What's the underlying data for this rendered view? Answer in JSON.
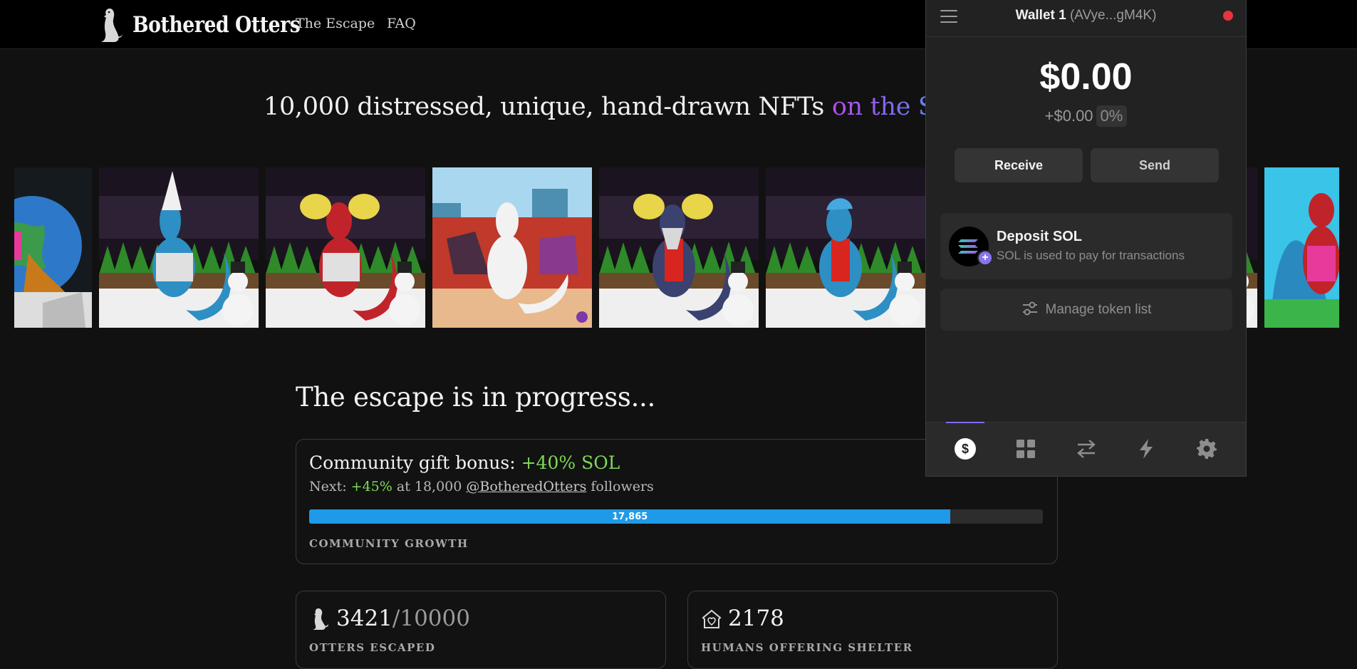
{
  "site": {
    "brand": "Bothered Otters",
    "nav": [
      {
        "label": "The Escape"
      },
      {
        "label": "FAQ"
      }
    ],
    "tagline_main": "10,000 distressed, unique, hand-drawn NFTs ",
    "tagline_highlight": "on the Solar"
  },
  "carousel": {
    "tiles": [
      {
        "subject": "otter-with-earth",
        "bg": "#1a1a1a"
      },
      {
        "subject": "blue-otter-dunce-cap",
        "otter_color": "#2d8fc4",
        "accessory": "#e8e8e8"
      },
      {
        "subject": "red-otter-pigtails",
        "otter_color": "#c0242a",
        "accessory": "#e8d54a"
      },
      {
        "subject": "white-otter-graffiti",
        "otter_color": "#f2f2f2",
        "accessory": "#7a3aa8"
      },
      {
        "subject": "navy-otter-pigtails-scarf",
        "otter_color": "#3b4270",
        "accessory": "#e8d54a"
      },
      {
        "subject": "blue-otter-cap-scarf",
        "otter_color": "#2d8fc4",
        "accessory": "#46a8e0"
      },
      {
        "subject": "partial-otter",
        "otter_color": "#2d8fc4"
      },
      {
        "subject": "red-otter-cyan-sky",
        "otter_color": "#c0242a"
      }
    ]
  },
  "progress": {
    "title": "The escape is in progress...",
    "gift_label": "Community gift bonus: ",
    "gift_value": "+40% SOL",
    "next_prefix": "Next: ",
    "next_value": "+45%",
    "next_middle": " at 18,000 ",
    "next_handle": "@BotheredOtters",
    "next_suffix": " followers",
    "bar_value": 17865,
    "bar_max": 20435,
    "bar_label": "17,865",
    "bar_caption": "COMMUNITY GROWTH",
    "bar_color": "#1f9ae8"
  },
  "stats": {
    "escaped_value": "3421",
    "escaped_total": "/10000",
    "escaped_caption": "OTTERS ESCAPED",
    "shelter_value": "2178",
    "shelter_caption": "HUMANS OFFERING SHELTER"
  },
  "wallet": {
    "name": "Wallet 1",
    "address": "(AVye...gM4K)",
    "balance": "$0.00",
    "change": "+$0.00",
    "change_pct": "0%",
    "receive_label": "Receive",
    "send_label": "Send",
    "deposit_title": "Deposit SOL",
    "deposit_subtitle": "SOL is used to pay for transactions",
    "manage_label": "Manage token list",
    "status_color": "#e8343f",
    "accent": "#7c6cf2",
    "tabs": [
      {
        "icon": "dollar-icon",
        "active": true
      },
      {
        "icon": "grid-icon",
        "active": false
      },
      {
        "icon": "swap-icon",
        "active": false
      },
      {
        "icon": "lightning-icon",
        "active": false
      },
      {
        "icon": "gear-icon",
        "active": false
      }
    ]
  }
}
